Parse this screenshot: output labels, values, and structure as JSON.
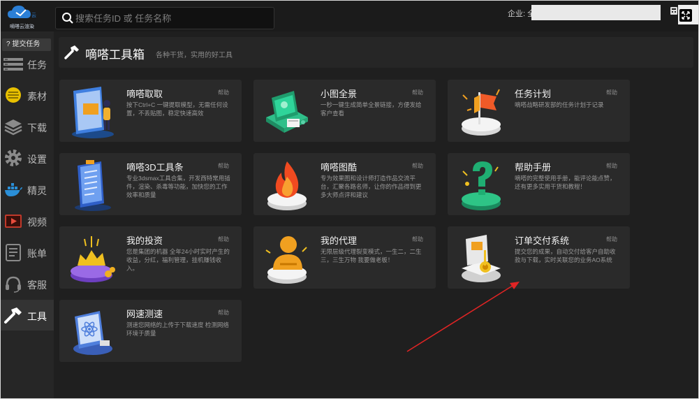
{
  "app": {
    "logo_text": "嘀嗒云渲染",
    "search_placeholder": "搜索任务ID 或 任务名称",
    "company_label": "企业: 全",
    "accent": "#e8a400"
  },
  "sidebar": {
    "submit_label": "? 提交任务",
    "items": [
      {
        "label": "任务",
        "icon": "task-list-icon"
      },
      {
        "label": "素材",
        "icon": "material-icon"
      },
      {
        "label": "下载",
        "icon": "download-layers-icon"
      },
      {
        "label": "设置",
        "icon": "gear-icon"
      },
      {
        "label": "精灵",
        "icon": "docker-whale-icon"
      },
      {
        "label": "视频",
        "icon": "video-icon"
      },
      {
        "label": "账单",
        "icon": "bill-icon"
      },
      {
        "label": "客服",
        "icon": "headset-icon"
      },
      {
        "label": "工具",
        "icon": "hammer-icon",
        "active": true
      }
    ]
  },
  "main": {
    "title": "嘀嗒工具箱",
    "subtitle": "各种干货，实用的好工具"
  },
  "help_label": "帮助",
  "cards": [
    {
      "title": "嘀嗒取取",
      "desc": "按下Ctrl+C 一键提取模型，无需任何设置，不丢贴图，稳定快速高效",
      "art": "pick-tool-art"
    },
    {
      "title": "小图全景",
      "desc": "一秒一键生成简单全景链接，方便发给客户查看",
      "art": "panorama-art"
    },
    {
      "title": "任务计划",
      "desc": "嘀嗒战略研发部的任务计划于记录",
      "art": "task-plan-flag-art"
    },
    {
      "title": "嘀嗒3D工具条",
      "desc": "专业3dsmax工具合集，开发西特常用插件，渲染、杀毒等功能，加快您的工作效率和质量",
      "art": "toolbar-book-art"
    },
    {
      "title": "嘀嗒图酷",
      "desc": "专为效果图和设计师打造作品交流平台，汇聚各路名师，让你的作品得到更多大师点评和建议",
      "art": "fire-art"
    },
    {
      "title": "帮助手册",
      "desc": "嘀嗒的完整使用手册，能评论能点赞，还有更多实用干货和教程！",
      "art": "question-mark-art"
    },
    {
      "title": "我的投资",
      "desc": "您是集团的机器 全年24小时实时产生的收益，分红，福利管理，挂机赚钱收入。",
      "art": "investment-coins-art"
    },
    {
      "title": "我的代理",
      "desc": "无限层级代理裂变模式，一生二，二生三，三生万物 我要做老板！",
      "art": "agent-person-art"
    },
    {
      "title": "订单交付系统",
      "desc": "提交您的成果，自动交付给客户自助收款与下载，实时关联您的业务AO系统",
      "art": "order-delivery-art"
    },
    {
      "title": "网速测速",
      "desc": "测速您网络的上传于下载速度 检测网络环境于质量",
      "art": "speed-test-atom-art"
    }
  ]
}
